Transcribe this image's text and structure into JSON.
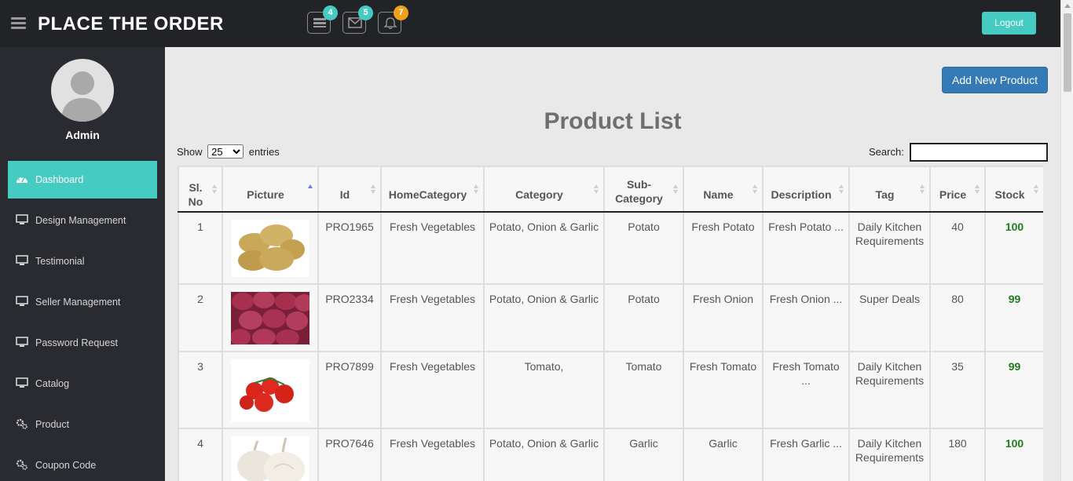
{
  "header": {
    "title": "PLACE THE ORDER",
    "badges": {
      "tasks": "4",
      "messages": "5",
      "alerts": "7"
    },
    "logout_label": "Logout"
  },
  "sidebar": {
    "user_name": "Admin",
    "items": [
      {
        "label": "Dashboard",
        "icon": "dashboard-icon"
      },
      {
        "label": "Design Management",
        "icon": "monitor-icon"
      },
      {
        "label": "Testimonial",
        "icon": "monitor-icon"
      },
      {
        "label": "Seller Management",
        "icon": "monitor-icon"
      },
      {
        "label": "Password Request",
        "icon": "monitor-icon"
      },
      {
        "label": "Catalog",
        "icon": "monitor-icon"
      },
      {
        "label": "Product",
        "icon": "gears-icon"
      },
      {
        "label": "Coupon Code",
        "icon": "gears-icon"
      }
    ]
  },
  "main": {
    "add_button": "Add New Product",
    "title": "Product List",
    "show_label": "Show",
    "entries_value": "25",
    "entries_label": "entries",
    "search_label": "Search:",
    "search_value": ""
  },
  "table": {
    "headers": {
      "slno": "Sl. No",
      "picture": "Picture",
      "id": "Id",
      "homecat": "HomeCategory",
      "category": "Category",
      "subcat": "Sub-Category",
      "name": "Name",
      "desc": "Description",
      "tag": "Tag",
      "price": "Price",
      "stock": "Stock"
    },
    "rows": [
      {
        "slno": "1",
        "picture": "potatoes",
        "id": "PRO1965",
        "homecat": "Fresh Vegetables",
        "category": "Potato, Onion & Garlic",
        "subcat": "Potato",
        "name": "Fresh Potato",
        "desc": "Fresh Potato ...",
        "tag": "Daily Kitchen Requirements",
        "price": "40",
        "stock": "100"
      },
      {
        "slno": "2",
        "picture": "onions",
        "id": "PRO2334",
        "homecat": "Fresh Vegetables",
        "category": "Potato, Onion & Garlic",
        "subcat": "Potato",
        "name": "Fresh Onion",
        "desc": "Fresh Onion ...",
        "tag": "Super Deals",
        "price": "80",
        "stock": "99"
      },
      {
        "slno": "3",
        "picture": "tomatoes",
        "id": "PRO7899",
        "homecat": "Fresh Vegetables",
        "category": "Tomato,",
        "subcat": "Tomato",
        "name": "Fresh Tomato",
        "desc": "Fresh Tomato ...",
        "tag": "Daily Kitchen Requirements",
        "price": "35",
        "stock": "99"
      },
      {
        "slno": "4",
        "picture": "garlic",
        "id": "PRO7646",
        "homecat": "Fresh Vegetables",
        "category": "Potato, Onion & Garlic",
        "subcat": "Garlic",
        "name": "Garlic",
        "desc": "Fresh Garlic ...",
        "tag": "Daily Kitchen Requirements",
        "price": "180",
        "stock": "100"
      }
    ]
  },
  "colors": {
    "accent": "#46cbc3",
    "primary": "#337ab7",
    "topbar": "#222327",
    "sidebar": "#2a2b30",
    "stock": "#1e7e1e"
  }
}
